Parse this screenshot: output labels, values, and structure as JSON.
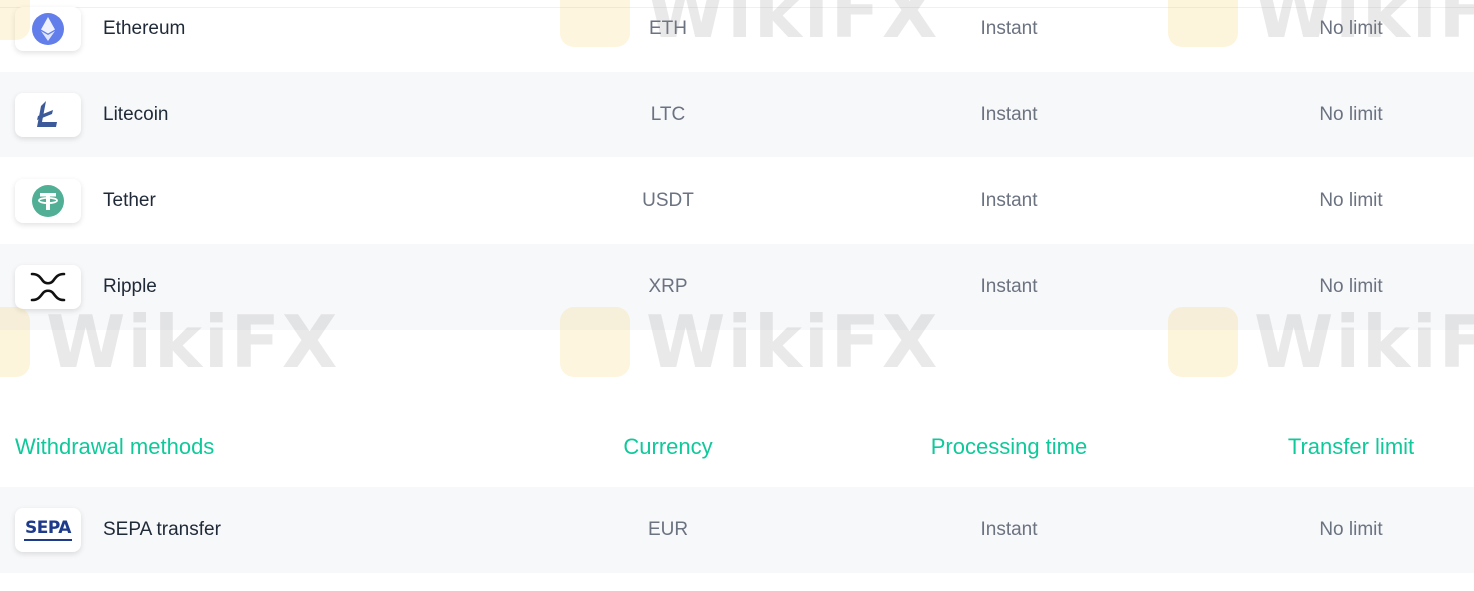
{
  "deposit_rows": [
    {
      "name": "Ethereum",
      "currency": "ETH",
      "processing_time": "Instant",
      "transfer_limit": "No limit",
      "icon": "ethereum-icon"
    },
    {
      "name": "Litecoin",
      "currency": "LTC",
      "processing_time": "Instant",
      "transfer_limit": "No limit",
      "icon": "litecoin-icon"
    },
    {
      "name": "Tether",
      "currency": "USDT",
      "processing_time": "Instant",
      "transfer_limit": "No limit",
      "icon": "tether-icon"
    },
    {
      "name": "Ripple",
      "currency": "XRP",
      "processing_time": "Instant",
      "transfer_limit": "No limit",
      "icon": "ripple-icon"
    }
  ],
  "withdrawal_header": {
    "method": "Withdrawal methods",
    "currency": "Currency",
    "processing_time": "Processing time",
    "transfer_limit": "Transfer limit"
  },
  "withdrawal_rows": [
    {
      "name": "SEPA transfer",
      "currency": "EUR",
      "processing_time": "Instant",
      "transfer_limit": "No limit",
      "icon": "sepa-icon",
      "logo_text": "SEPA"
    }
  ],
  "watermark": {
    "text": "WikiFX"
  },
  "colors": {
    "accent": "#10c99a",
    "row_shade": "#f7f8fa",
    "muted_text": "#6b7280",
    "primary_text": "#1f2937"
  }
}
